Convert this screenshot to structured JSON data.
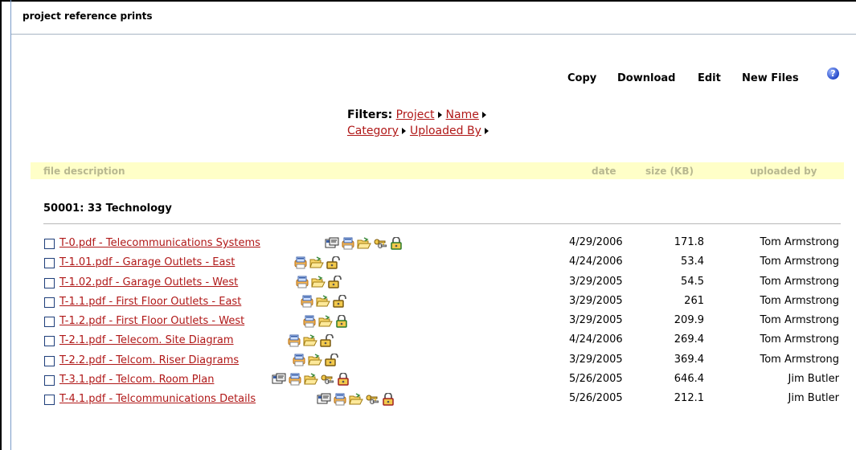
{
  "panel": {
    "title": "project reference prints"
  },
  "toolbar": {
    "copy_label": "Copy",
    "download_label": "Download",
    "edit_label": "Edit",
    "new_files_label": "New Files",
    "help_icon": "help-question-icon"
  },
  "filters": {
    "label": "Filters:",
    "items": [
      "Project",
      "Name",
      "Category",
      "Uploaded By"
    ]
  },
  "table": {
    "headers": {
      "description": "file description",
      "date": "date",
      "size": "size (KB)",
      "uploaded_by": "uploaded by"
    },
    "group": "50001: 33 Technology",
    "rows": [
      {
        "name": "T-0.pdf - Telecommunications Systems",
        "date": "4/29/2006",
        "size": "171.8",
        "user": "Tom Armstrong",
        "icons": [
          "properties-icon",
          "print-icon",
          "open-folder-icon",
          "keys-icon",
          "lock-closed-green-icon"
        ]
      },
      {
        "name": "T-1.01.pdf - Garage Outlets - East",
        "date": "4/24/2006",
        "size": "53.4",
        "user": "Tom Armstrong",
        "icons": [
          "print-icon",
          "open-folder-icon",
          "lock-open-icon"
        ]
      },
      {
        "name": "T-1.02.pdf - Garage Outlets - West",
        "date": "3/29/2005",
        "size": "54.5",
        "user": "Tom Armstrong",
        "icons": [
          "print-icon",
          "open-folder-icon",
          "lock-open-icon"
        ]
      },
      {
        "name": "T-1.1.pdf - First Floor Outlets - East",
        "date": "3/29/2005",
        "size": "261",
        "user": "Tom Armstrong",
        "icons": [
          "print-icon",
          "open-folder-icon",
          "lock-open-icon"
        ]
      },
      {
        "name": "T-1.2.pdf - First Floor Outlets - West",
        "date": "3/29/2005",
        "size": "209.9",
        "user": "Tom Armstrong",
        "icons": [
          "print-icon",
          "open-folder-icon",
          "lock-closed-green-icon"
        ]
      },
      {
        "name": "T-2.1.pdf - Telecom. Site Diagram",
        "date": "4/24/2006",
        "size": "269.4",
        "user": "Tom Armstrong",
        "icons": [
          "print-icon",
          "open-folder-icon",
          "lock-open-icon"
        ]
      },
      {
        "name": "T-2.2.pdf - Telcom. Riser Diagrams",
        "date": "3/29/2005",
        "size": "369.4",
        "user": "Tom Armstrong",
        "icons": [
          "print-icon",
          "open-folder-icon",
          "lock-open-icon"
        ]
      },
      {
        "name": "T-3.1.pdf - Telcom. Room Plan",
        "date": "5/26/2005",
        "size": "646.4",
        "user": "Jim Butler",
        "icons": [
          "properties-icon",
          "print-icon",
          "open-folder-icon",
          "keys-icon",
          "lock-closed-red-icon"
        ]
      },
      {
        "name": "T-4.1.pdf - Telcommunications Details",
        "date": "5/26/2005",
        "size": "212.1",
        "user": "Jim Butler",
        "icons": [
          "properties-icon",
          "print-icon",
          "open-folder-icon",
          "keys-icon",
          "lock-closed-red-icon"
        ]
      }
    ]
  },
  "colors": {
    "link": "#b01818",
    "header_bg": "#ffffc8",
    "header_text": "#b8b890",
    "checkbox_border": "#1e3e7a"
  }
}
